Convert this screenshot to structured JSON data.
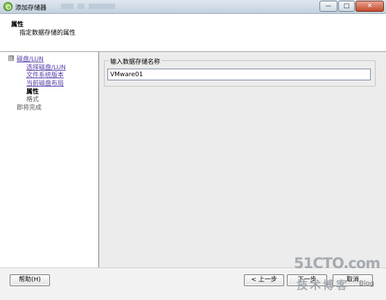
{
  "window": {
    "title": "添加存储器",
    "min_label": "—",
    "max_label": "□",
    "close_label": "✕"
  },
  "header": {
    "title": "属性",
    "subtitle": "指定数据存储的属性"
  },
  "nav": {
    "toggle": "⊟",
    "items": [
      {
        "label": "磁盘/LUN",
        "state": "link"
      },
      {
        "label": "选择磁盘/LUN",
        "state": "link"
      },
      {
        "label": "文件系统版本",
        "state": "link"
      },
      {
        "label": "当前磁盘布局",
        "state": "link"
      },
      {
        "label": "属性",
        "state": "current"
      },
      {
        "label": "格式",
        "state": "pending"
      },
      {
        "label": "即将完成",
        "state": "pending"
      }
    ]
  },
  "form": {
    "group_label": "输入数据存储名称",
    "datastore_name": "VMware01"
  },
  "buttons": {
    "help": "帮助(H)",
    "back": "< 上一步",
    "next": "下一步",
    "cancel": "取消"
  },
  "watermark": {
    "brand": "51CTO.com",
    "tagline": "技术博客",
    "blog": "Blog"
  }
}
